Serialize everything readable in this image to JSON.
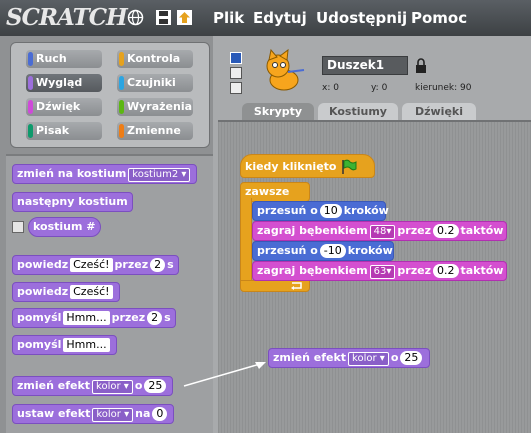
{
  "app": {
    "logo": "SCRATCH"
  },
  "menu": {
    "file": "Plik",
    "edit": "Edytuj",
    "share": "Udostępnij",
    "help": "Pomoc"
  },
  "categories": [
    {
      "label": "Ruch",
      "color": "#4a6cd4"
    },
    {
      "label": "Kontrola",
      "color": "#e6a21e"
    },
    {
      "label": "Wygląd",
      "color": "#9c6fdc"
    },
    {
      "label": "Czujniki",
      "color": "#2ca5e2"
    },
    {
      "label": "Dźwięk",
      "color": "#cf4ad9"
    },
    {
      "label": "Wyrażenia",
      "color": "#5cb712"
    },
    {
      "label": "Pisak",
      "color": "#0e9a6c"
    },
    {
      "label": "Zmienne",
      "color": "#ee7d16"
    }
  ],
  "palette": {
    "b1": {
      "text": "zmień na kostium",
      "dd": "kostium2"
    },
    "b2": {
      "text": "następny kostium"
    },
    "b3": {
      "text": "kostium #"
    },
    "b4": {
      "a": "powiedz",
      "v1": "Cześć!",
      "b": "przez",
      "v2": "2",
      "c": "s"
    },
    "b5": {
      "a": "powiedz",
      "v1": "Cześć!"
    },
    "b6": {
      "a": "pomyśl",
      "v1": "Hmm...",
      "b": "przez",
      "v2": "2",
      "c": "s"
    },
    "b7": {
      "a": "pomyśl",
      "v1": "Hmm..."
    },
    "b8": {
      "a": "zmień efekt",
      "dd": "kolor",
      "b": "o",
      "v": "25"
    },
    "b9": {
      "a": "ustaw efekt",
      "dd": "kolor",
      "b": "na",
      "v": "0"
    }
  },
  "sprite": {
    "name": "Duszek1",
    "x": "x: 0",
    "y": "y: 0",
    "dir": "kierunek: 90"
  },
  "tabs": {
    "scripts": "Skrypty",
    "costumes": "Kostiumy",
    "sounds": "Dźwięki"
  },
  "script": {
    "hat": "kiedy kliknięto",
    "forever": "zawsze",
    "m1": {
      "a": "przesuń o",
      "v": "10",
      "b": "kroków"
    },
    "d1": {
      "a": "zagraj bębenkiem",
      "dd": "48",
      "b": "przez",
      "v": "0.2",
      "c": "taktów"
    },
    "m2": {
      "a": "przesuń o",
      "v": "-10",
      "b": "kroków"
    },
    "d2": {
      "a": "zagraj bębenkiem",
      "dd": "63",
      "b": "przez",
      "v": "0.2",
      "c": "taktów"
    },
    "drag": {
      "a": "zmień efekt",
      "dd": "kolor",
      "b": "o",
      "v": "25"
    }
  }
}
